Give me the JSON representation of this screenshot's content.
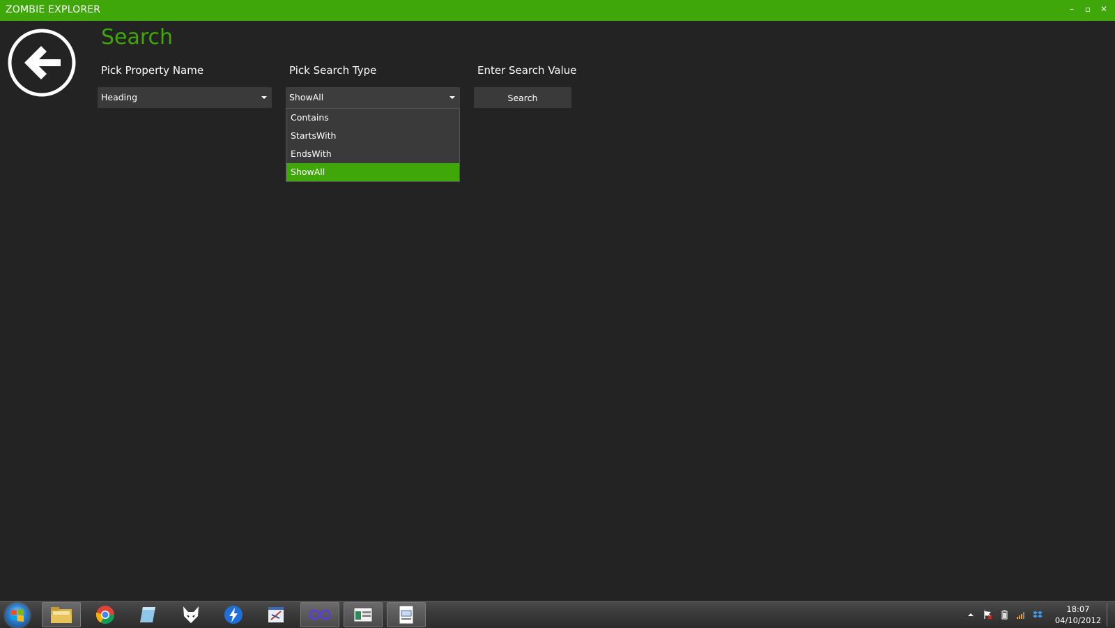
{
  "window": {
    "title": "ZOMBIE EXPLORER",
    "controls": {
      "minimize": "–",
      "maximize": "▫",
      "close": "✕"
    }
  },
  "page": {
    "title": "Search",
    "back_icon": "arrow-left-circle-icon"
  },
  "form": {
    "property_label": "Pick Property Name",
    "property_value": "Heading",
    "search_type_label": "Pick Search Type",
    "search_type_value": "ShowAll",
    "search_type_options": [
      "Contains",
      "StartsWith",
      "EndsWith",
      "ShowAll"
    ],
    "search_type_selected_index": 3,
    "value_label": "Enter Search Value",
    "search_button": "Search"
  },
  "taskbar": {
    "apps": [
      {
        "name": "windows-explorer-icon",
        "active": true
      },
      {
        "name": "chrome-icon",
        "active": false
      },
      {
        "name": "notepad-icon",
        "active": false
      },
      {
        "name": "fox-icon",
        "active": false
      },
      {
        "name": "lightning-icon",
        "active": false
      },
      {
        "name": "paint-icon",
        "active": false
      },
      {
        "name": "infinity-icon",
        "active": true
      },
      {
        "name": "window-app-icon",
        "active": true
      },
      {
        "name": "document-app-icon",
        "active": true
      }
    ],
    "tray_icons": [
      "show-hidden-icons-arrow",
      "action-center-flag-icon",
      "battery-icon",
      "network-icon",
      "dropbox-icon"
    ],
    "clock_time": "18:07",
    "clock_date": "04/10/2012"
  },
  "colors": {
    "accent": "#3fa70a",
    "background": "#232323",
    "control": "#3a3a3a"
  }
}
